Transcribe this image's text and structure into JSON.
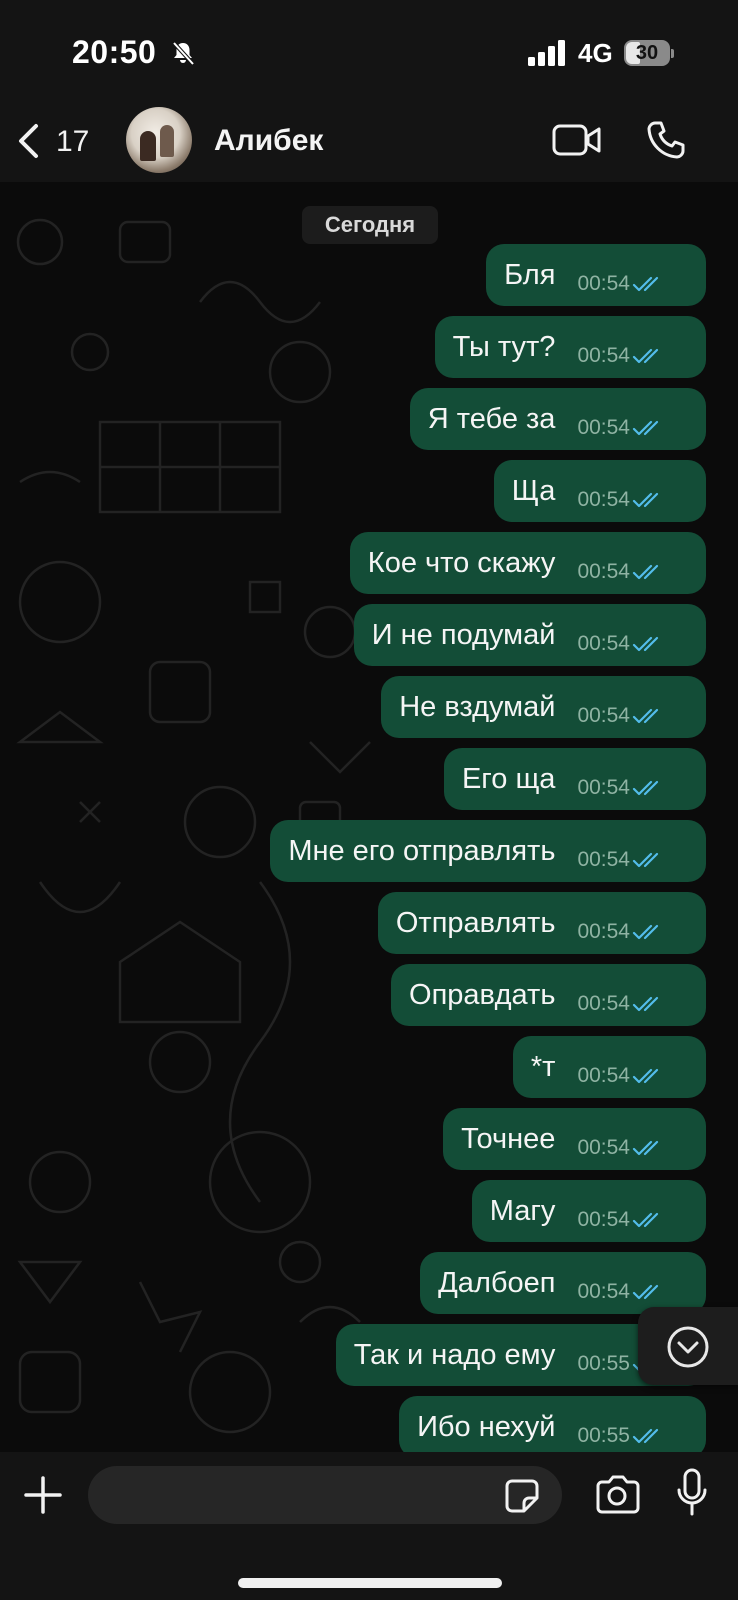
{
  "status_bar": {
    "time": "20:50",
    "network": "4G",
    "battery": "30",
    "icons": [
      "bell-slash-icon",
      "signal-icon",
      "battery-icon"
    ]
  },
  "header": {
    "back_count": "17",
    "contact_name": "Алибек",
    "icons": [
      "chevron-left-icon",
      "video-call-icon",
      "phone-call-icon"
    ]
  },
  "chat": {
    "date_separator": "Сегодня",
    "messages": [
      {
        "text": "Бля",
        "time": "00:54",
        "status": "read"
      },
      {
        "text": "Ты тут?",
        "time": "00:54",
        "status": "read"
      },
      {
        "text": "Я тебе за",
        "time": "00:54",
        "status": "read"
      },
      {
        "text": "Ща",
        "time": "00:54",
        "status": "read"
      },
      {
        "text": "Кое что скажу",
        "time": "00:54",
        "status": "read"
      },
      {
        "text": "И не подумай",
        "time": "00:54",
        "status": "read"
      },
      {
        "text": "Не вздумай",
        "time": "00:54",
        "status": "read"
      },
      {
        "text": "Его ща",
        "time": "00:54",
        "status": "read"
      },
      {
        "text": "Мне его отправлять",
        "time": "00:54",
        "status": "read"
      },
      {
        "text": "Отправлять",
        "time": "00:54",
        "status": "read"
      },
      {
        "text": "Оправдать",
        "time": "00:54",
        "status": "read"
      },
      {
        "text": "*т",
        "time": "00:54",
        "status": "read"
      },
      {
        "text": "Точнее",
        "time": "00:54",
        "status": "read"
      },
      {
        "text": "Магу",
        "time": "00:54",
        "status": "read"
      },
      {
        "text": "Далбоеп",
        "time": "00:54",
        "status": "read"
      },
      {
        "text": "Так и надо ему",
        "time": "00:55",
        "status": "read"
      },
      {
        "text": "Ибо нехуй",
        "time": "00:55",
        "status": "read"
      }
    ],
    "scroll_button_icon": "chevron-down-circle-icon"
  },
  "input_bar": {
    "placeholder": "",
    "value": "",
    "icons": [
      "plus-icon",
      "sticker-icon",
      "camera-icon",
      "microphone-icon"
    ]
  },
  "colors": {
    "background": "#0b0b0b",
    "bar": "#141414",
    "outgoing_bubble": "#134d37",
    "read_tick": "#53bdeb",
    "timestamp": "#8fb3a3"
  }
}
